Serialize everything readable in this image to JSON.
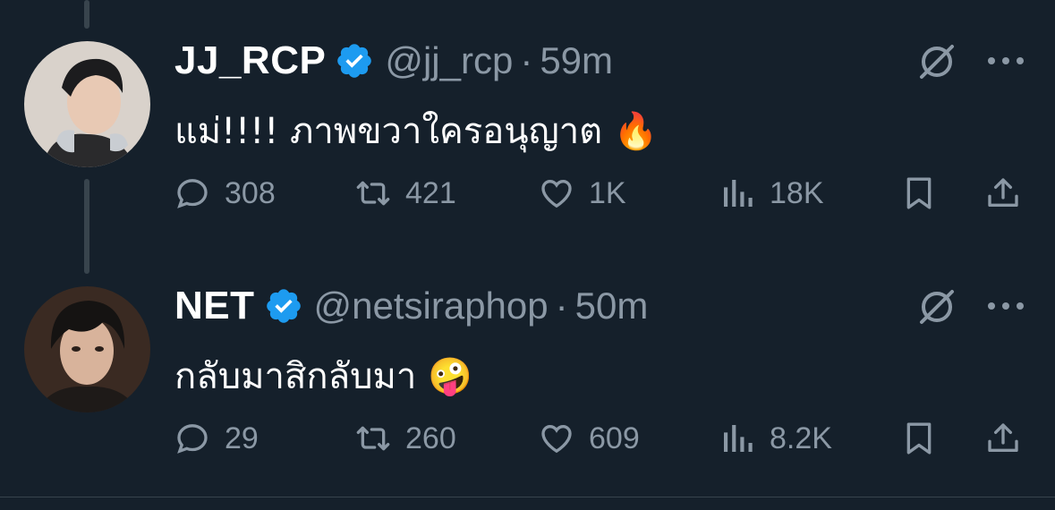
{
  "colors": {
    "background": "#15202b",
    "primary_text": "#ffffff",
    "secondary_text": "#8b98a5",
    "verified_badge": "#1d9bf0",
    "divider": "#38444d"
  },
  "tweets": [
    {
      "display_name": "JJ_RCP",
      "verified": true,
      "handle": "@jj_rcp",
      "separator": "·",
      "time": "59m",
      "text": "แม่!!!! ภาพขวาใครอนุญาต",
      "emoji": "🔥",
      "emoji_name": "fire-emoji",
      "stats": {
        "replies": "308",
        "reposts": "421",
        "likes": "1K",
        "views": "18K"
      },
      "icons": [
        "grok-icon",
        "more-icon",
        "reply-icon",
        "repost-icon",
        "like-icon",
        "views-icon",
        "bookmark-icon",
        "share-icon"
      ]
    },
    {
      "display_name": "NET",
      "verified": true,
      "handle": "@netsiraphop",
      "separator": "·",
      "time": "50m",
      "text": "กลับมาสิกลับมา",
      "emoji": "🤪",
      "emoji_name": "zany-face-emoji",
      "stats": {
        "replies": "29",
        "reposts": "260",
        "likes": "609",
        "views": "8.2K"
      },
      "icons": [
        "grok-icon",
        "more-icon",
        "reply-icon",
        "repost-icon",
        "like-icon",
        "views-icon",
        "bookmark-icon",
        "share-icon"
      ]
    }
  ]
}
